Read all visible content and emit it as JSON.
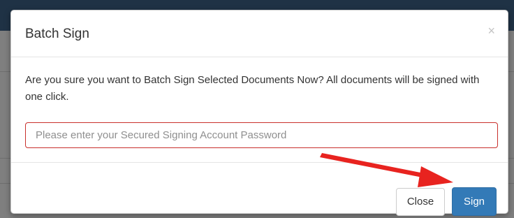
{
  "dialog": {
    "title": "Batch Sign",
    "close_symbol": "×",
    "message": "Are you sure you want to Batch Sign Selected Documents Now? All documents will be signed with one click.",
    "password_input": {
      "value": "",
      "placeholder": "Please enter your Secured Signing Account Password"
    },
    "buttons": {
      "close_label": "Close",
      "sign_label": "Sign"
    }
  },
  "annotation": {
    "type": "arrow",
    "points_to": "sign-button",
    "color": "#e8231f"
  },
  "colors": {
    "primary_button": "#337ab7",
    "input_border_error": "#c9302c",
    "backdrop": "#7f7f7f"
  }
}
